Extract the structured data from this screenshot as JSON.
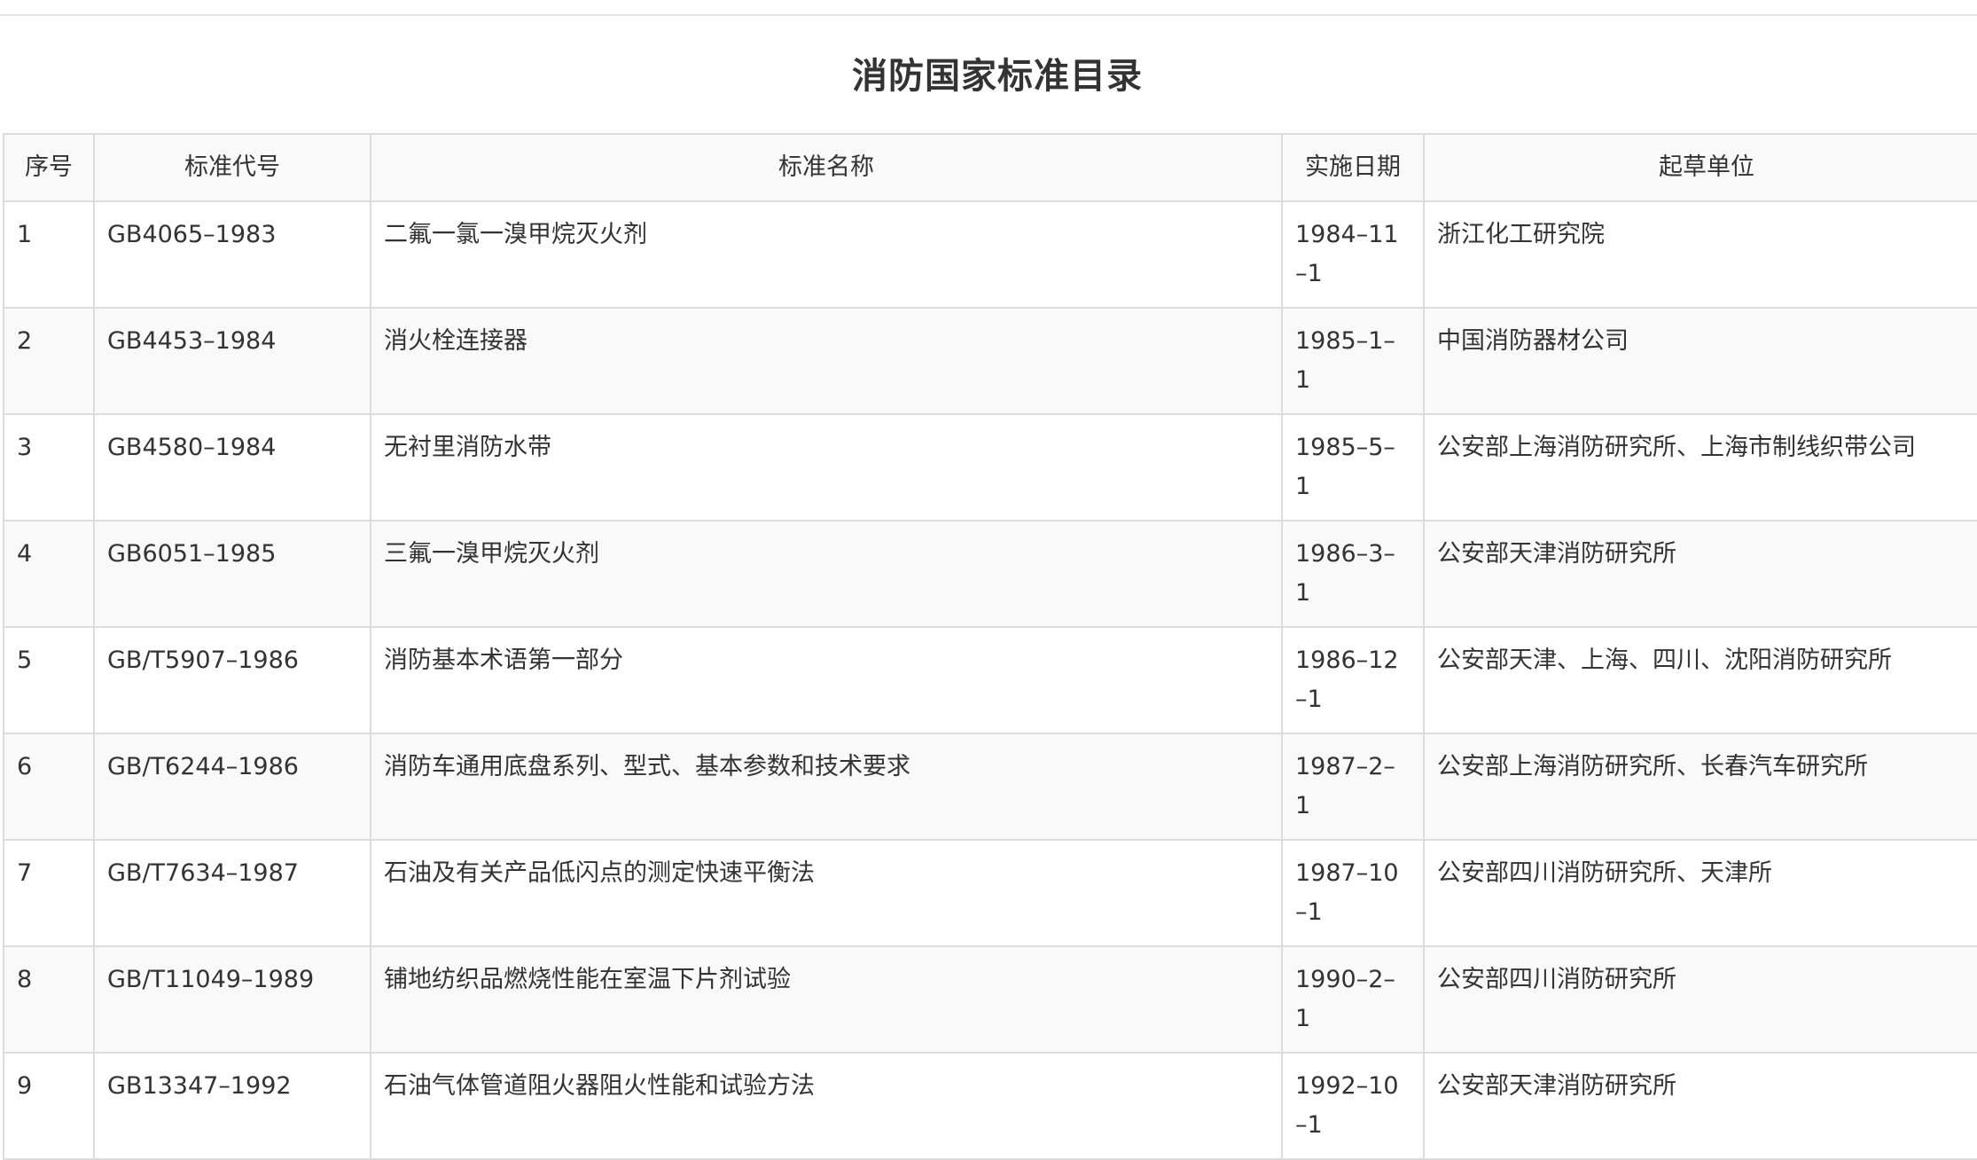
{
  "page": {
    "title": "消防国家标准目录"
  },
  "table": {
    "headers": {
      "seq": "序号",
      "code": "标准代号",
      "name": "标准名称",
      "date": "实施日期",
      "org": "起草单位"
    },
    "rows": [
      {
        "seq": "1",
        "code": "GB4065–1983",
        "name": "二氟一氯一溴甲烷灭火剂",
        "date": "1984–11–1",
        "org": "浙江化工研究院"
      },
      {
        "seq": "2",
        "code": "GB4453–1984",
        "name": "消火栓连接器",
        "date": "1985–1–1",
        "org": "中国消防器材公司"
      },
      {
        "seq": "3",
        "code": "GB4580–1984",
        "name": "无衬里消防水带",
        "date": "1985–5–1",
        "org": "公安部上海消防研究所、上海市制线织带公司"
      },
      {
        "seq": "4",
        "code": "GB6051–1985",
        "name": "三氟一溴甲烷灭火剂",
        "date": "1986–3–1",
        "org": "公安部天津消防研究所"
      },
      {
        "seq": "5",
        "code": "GB/T5907–1986",
        "name": "消防基本术语第一部分",
        "date": "1986–12–1",
        "org": "公安部天津、上海、四川、沈阳消防研究所"
      },
      {
        "seq": "6",
        "code": "GB/T6244–1986",
        "name": "消防车通用底盘系列、型式、基本参数和技术要求",
        "date": "1987–2–1",
        "org": "公安部上海消防研究所、长春汽车研究所"
      },
      {
        "seq": "7",
        "code": "GB/T7634–1987",
        "name": "石油及有关产品低闪点的测定快速平衡法",
        "date": "1987–10–1",
        "org": "公安部四川消防研究所、天津所"
      },
      {
        "seq": "8",
        "code": "GB/T11049–1989",
        "name": "铺地纺织品燃烧性能在室温下片剂试验",
        "date": "1990–2–1",
        "org": "公安部四川消防研究所"
      },
      {
        "seq": "9",
        "code": "GB13347–1992",
        "name": "石油气体管道阻火器阻火性能和试验方法",
        "date": "1992–10–1",
        "org": "公安部天津消防研究所"
      }
    ]
  }
}
